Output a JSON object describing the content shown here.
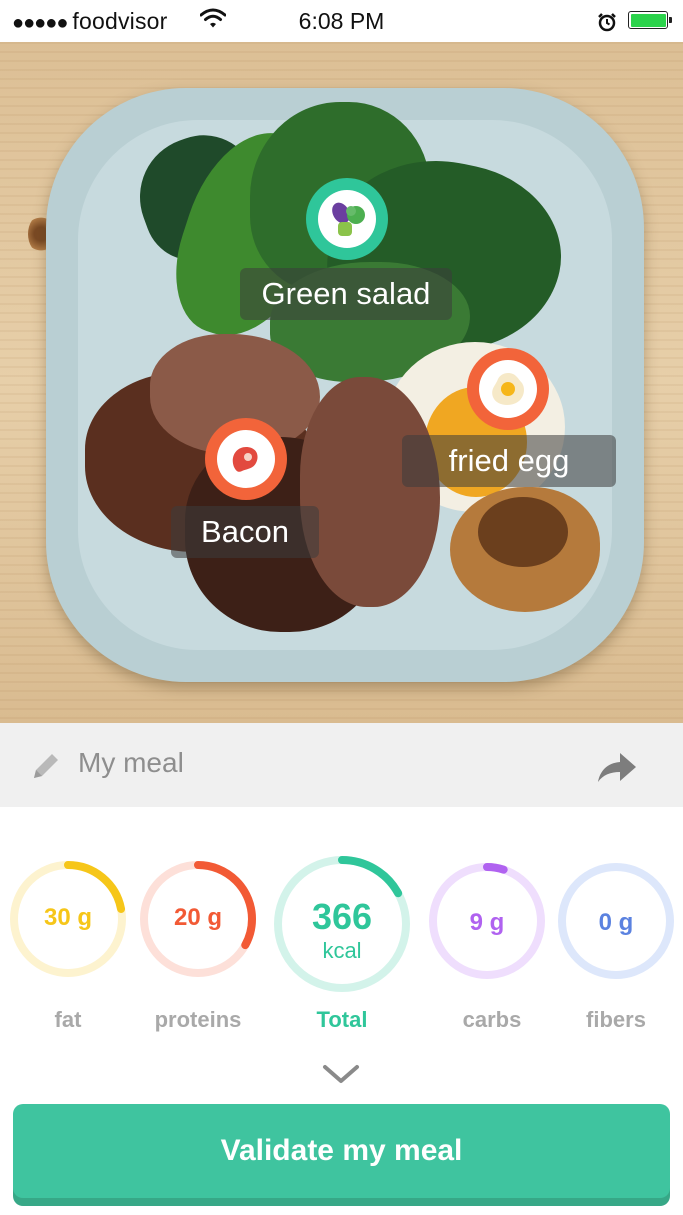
{
  "status_bar": {
    "signal_dots": "●●●●●",
    "carrier": "foodvisor",
    "time": "6:08 PM",
    "icons": [
      "wifi-icon",
      "alarm-icon",
      "battery-icon"
    ],
    "battery_color": "#2bd34b"
  },
  "photo": {
    "tags": [
      {
        "label": "Green salad",
        "icon": "vegetables-icon",
        "ring_color": "#2fc69a"
      },
      {
        "label": "fried egg",
        "icon": "egg-icon",
        "ring_color": "#f2643a"
      },
      {
        "label": "Bacon",
        "icon": "meat-icon",
        "ring_color": "#f2643a"
      }
    ]
  },
  "meal": {
    "name": "My meal",
    "edit_icon": "pencil-icon",
    "share_icon": "share-arrow-icon"
  },
  "nutrients": {
    "fat": {
      "value": "30 g",
      "label": "fat",
      "color": "#f6c619",
      "track": "#fdf3cf",
      "fraction": 0.22
    },
    "proteins": {
      "value": "20 g",
      "label": "proteins",
      "color": "#f25a35",
      "track": "#fde0d9",
      "fraction": 0.33
    },
    "total": {
      "value": "366",
      "unit": "kcal",
      "label": "Total",
      "color": "#2fc69a",
      "track": "#d3f3ea",
      "fraction": 0.17
    },
    "carbs": {
      "value": "9 g",
      "label": "carbs",
      "color": "#b062f0",
      "track": "#efdefd",
      "fraction": 0.05
    },
    "fibers": {
      "value": "0 g",
      "label": "fibers",
      "color": "#5b82e0",
      "track": "#dde7fb",
      "fraction": 0.0
    }
  },
  "expand_icon": "chevron-down-icon",
  "cta": {
    "label": "Validate my meal",
    "color": "#3fc49f"
  }
}
